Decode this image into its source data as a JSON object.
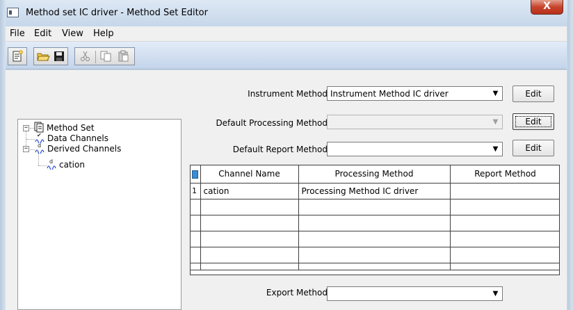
{
  "window": {
    "title": "Method set IC driver - Method Set Editor",
    "close_glyph": "X"
  },
  "menu": {
    "items": [
      "File",
      "Edit",
      "View",
      "Help"
    ]
  },
  "toolbar": {
    "buttons": [
      "new-icon",
      "open-icon",
      "save-icon",
      "cut-icon",
      "copy-icon",
      "paste-icon"
    ]
  },
  "tree": {
    "root": {
      "label": "Method Set",
      "expander": "−"
    },
    "children": [
      {
        "label": "Data Channels"
      },
      {
        "label": "Derived Channels",
        "expander": "−"
      }
    ],
    "grandchildren": [
      {
        "label": "cation"
      }
    ]
  },
  "form": {
    "instrument_method": {
      "label": "Instrument Method",
      "value": "Instrument Method IC driver",
      "button": "Edit"
    },
    "default_processing_method": {
      "label": "Default Processing Method",
      "value": "",
      "button": "Edit",
      "disabled": true
    },
    "default_report_method": {
      "label": "Default Report Method",
      "value": "",
      "button": "Edit"
    },
    "export_method": {
      "label": "Export Method",
      "value": ""
    }
  },
  "grid": {
    "columns": [
      "Channel Name",
      "Processing Method",
      "Report Method"
    ],
    "rows": [
      {
        "num": "1",
        "channel": "cation",
        "processing": "Processing Method IC driver",
        "report": ""
      },
      {
        "num": "",
        "channel": "",
        "processing": "",
        "report": ""
      },
      {
        "num": "",
        "channel": "",
        "processing": "",
        "report": ""
      },
      {
        "num": "",
        "channel": "",
        "processing": "",
        "report": ""
      },
      {
        "num": "",
        "channel": "",
        "processing": "",
        "report": ""
      },
      {
        "num": "",
        "channel": "",
        "processing": "",
        "report": ""
      }
    ]
  },
  "glyphs": {
    "dropdown_arrow": "▼"
  }
}
